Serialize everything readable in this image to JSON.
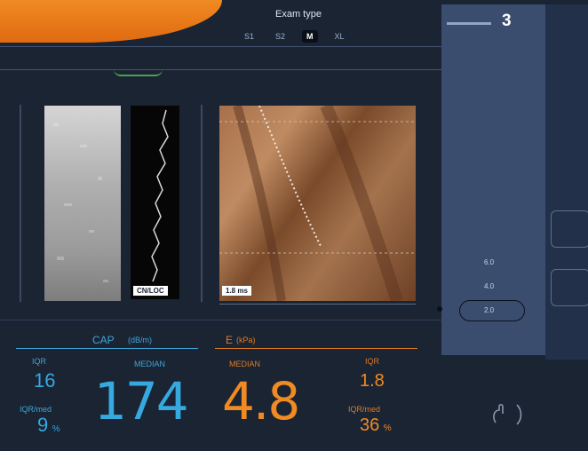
{
  "header": {
    "brand_text": "",
    "probe_type_label": "Exam type",
    "probe_options": [
      "S1",
      "S2",
      "M",
      "XL"
    ],
    "active_probe": "M"
  },
  "right_panel": {
    "level_caption": "",
    "level_value": "3",
    "scale_values": [
      "6.0",
      "4.0",
      "2.0"
    ],
    "selected_scale": "2.0"
  },
  "images": {
    "mmode_label": "CN/LOC",
    "elasto_label": "1.8 ms"
  },
  "metrics": {
    "cap": {
      "title": "CAP",
      "unit": "(dB/m)",
      "iqr_label": "IQR",
      "iqr_value": "16",
      "median_label": "MEDIAN",
      "median_value": "174",
      "iqr_med_label": "IQR/med",
      "iqr_med_value": "9",
      "iqr_med_unit": "%"
    },
    "e": {
      "title": "E",
      "unit": "(kPa)",
      "median_label": "MEDIAN",
      "median_value": "4.8",
      "iqr_label": "IQR",
      "iqr_value": "1.8",
      "iqr_med_label": "IQR/med",
      "iqr_med_value": "36",
      "iqr_med_unit": "%"
    }
  },
  "colors": {
    "cap_accent": "#35a9e0",
    "e_accent": "#f08a22",
    "background": "#1a2433",
    "right_panel": "#3a4d6e"
  }
}
